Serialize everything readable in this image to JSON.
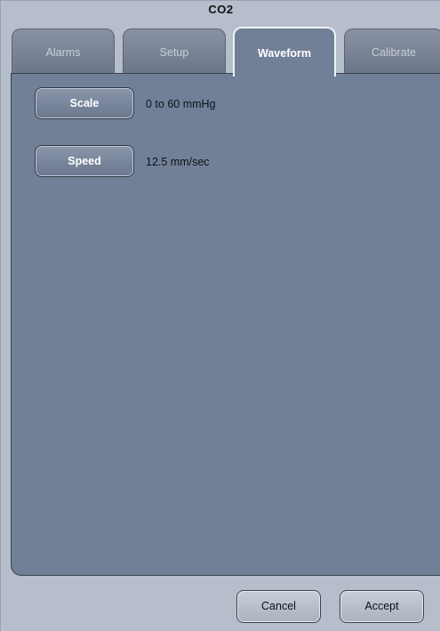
{
  "window": {
    "title": "CO2"
  },
  "tabs": [
    {
      "label": "Alarms",
      "active": false
    },
    {
      "label": "Setup",
      "active": false
    },
    {
      "label": "Waveform",
      "active": true
    },
    {
      "label": "Calibrate",
      "active": false
    }
  ],
  "waveform": {
    "scale": {
      "button_label": "Scale",
      "value": "0 to 60 mmHg"
    },
    "speed": {
      "button_label": "Speed",
      "value": "12.5 mm/sec"
    }
  },
  "footer": {
    "cancel_label": "Cancel",
    "accept_label": "Accept"
  },
  "colors": {
    "panel_background": "#b6bdcb",
    "content_background": "#728097",
    "tab_inactive": "#6b7588",
    "button_face": "#7b879c"
  }
}
